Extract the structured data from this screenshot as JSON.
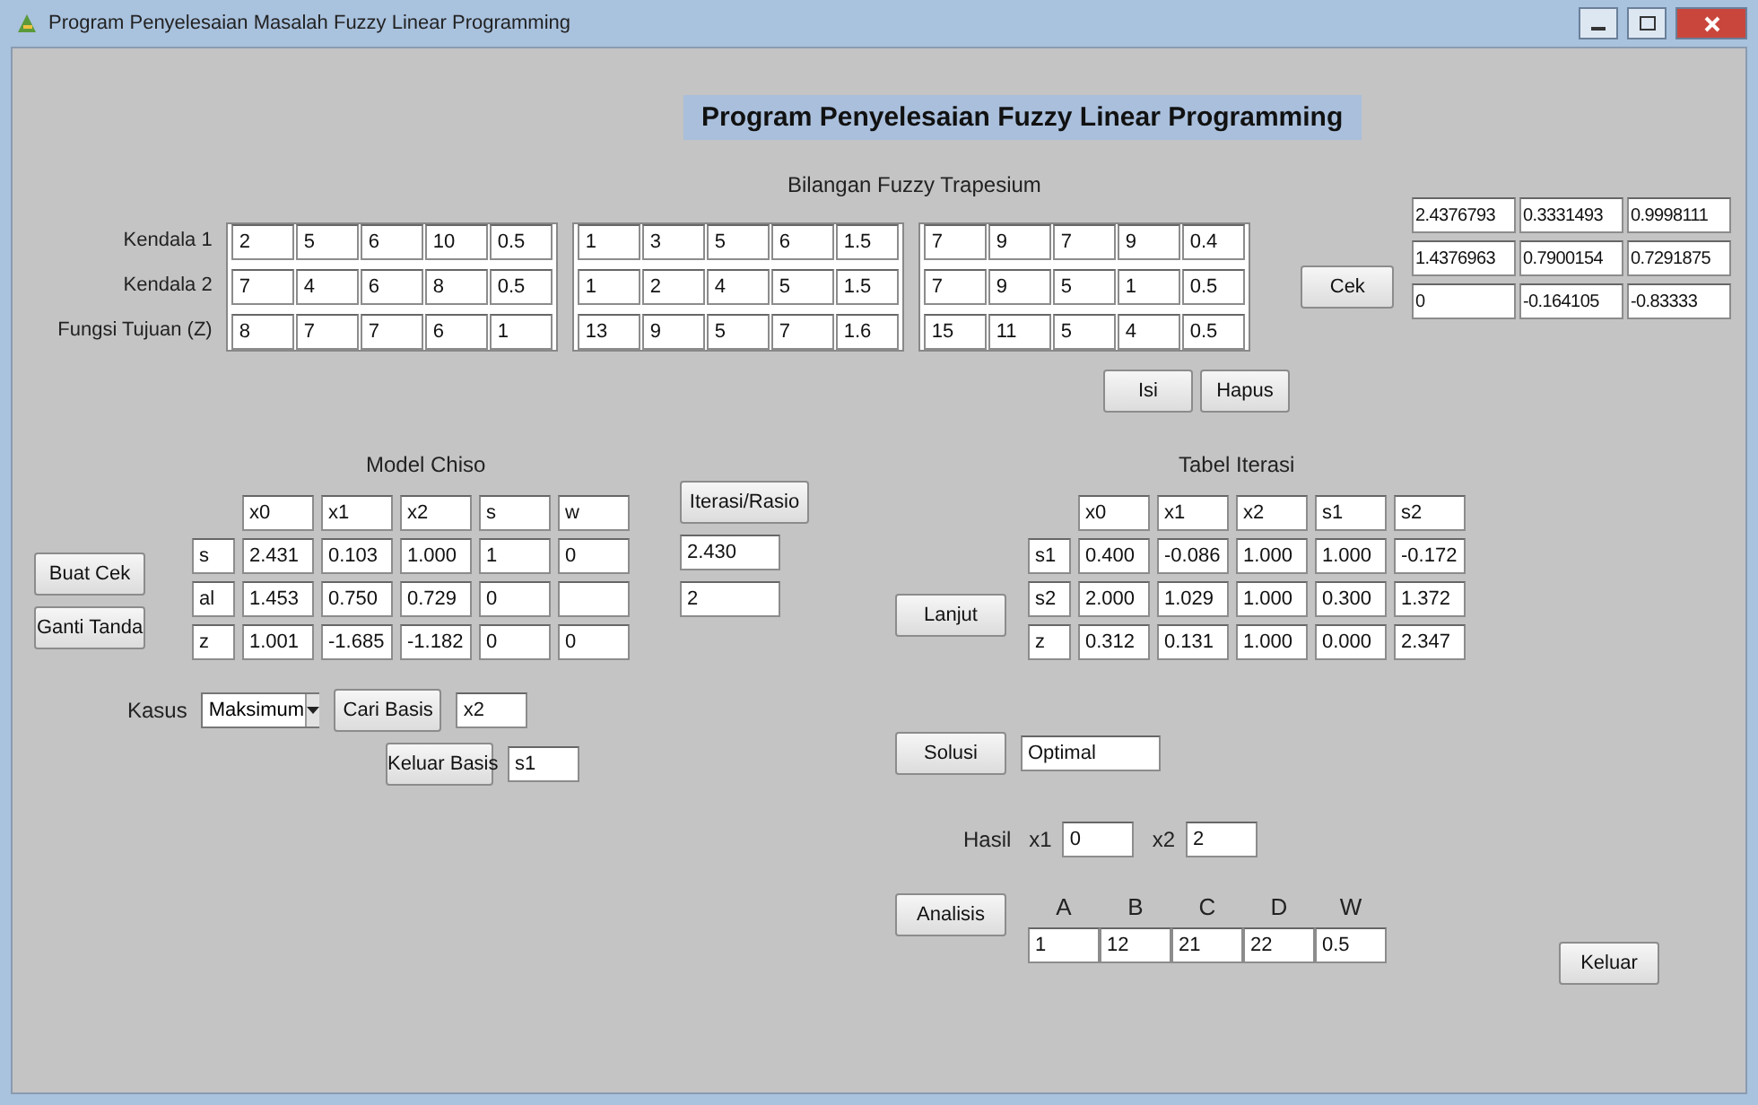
{
  "window": {
    "title": "Program Penyelesaian Masalah Fuzzy Linear Programming"
  },
  "heading": "Program Penyelesaian Fuzzy Linear Programming",
  "fuzzy": {
    "title": "Bilangan Fuzzy Trapesium",
    "rows": [
      {
        "label": "Kendala 1",
        "groups": [
          [
            "2",
            "5",
            "6",
            "10",
            "0.5"
          ],
          [
            "1",
            "3",
            "5",
            "6",
            "1.5"
          ],
          [
            "7",
            "9",
            "7",
            "9",
            "0.4"
          ]
        ]
      },
      {
        "label": "Kendala 2",
        "groups": [
          [
            "7",
            "4",
            "6",
            "8",
            "0.5"
          ],
          [
            "1",
            "2",
            "4",
            "5",
            "1.5"
          ],
          [
            "7",
            "9",
            "5",
            "1",
            "0.5"
          ]
        ]
      },
      {
        "label": "Fungsi Tujuan (Z)",
        "groups": [
          [
            "8",
            "7",
            "7",
            "6",
            "1"
          ],
          [
            "13",
            "9",
            "5",
            "7",
            "1.6"
          ],
          [
            "15",
            "11",
            "5",
            "4",
            "0.5"
          ]
        ]
      }
    ],
    "check_button": "Cek",
    "results": [
      [
        "2.4376793",
        "0.3331493",
        "0.9998111"
      ],
      [
        "1.4376963",
        "0.7900154",
        "0.7291875"
      ],
      [
        "0",
        "-0.164105",
        "-0.83333"
      ]
    ],
    "buttons": [
      "Isi",
      "Hapus"
    ]
  },
  "model": {
    "title": "Model Chiso",
    "headers": [
      "x0",
      "x1",
      "x2",
      "s",
      "w"
    ],
    "rows": [
      {
        "label": "s",
        "cells": [
          "2.431",
          "0.103",
          "1.000",
          "1",
          "0"
        ]
      },
      {
        "label": "al",
        "cells": [
          "1.453",
          "0.750",
          "0.729",
          "0",
          ""
        ]
      },
      {
        "label": "z",
        "cells": [
          "1.001",
          "-1.685",
          "-1.182",
          "0",
          "0"
        ]
      }
    ],
    "side_buttons": [
      "Buat Cek",
      "Ganti Tanda"
    ],
    "ratio_button": "Iterasi/Rasio",
    "ratios": [
      "2.430",
      "2"
    ]
  },
  "kasus": {
    "label": "Kasus",
    "select": "Maksimum",
    "actions": [
      {
        "button": "Cari Basis",
        "value": "x2"
      },
      {
        "button": "Keluar Basis",
        "value": "s1"
      }
    ]
  },
  "iteration": {
    "title": "Tabel Iterasi",
    "headers": [
      "x0",
      "x1",
      "x2",
      "s1",
      "s2"
    ],
    "rows": [
      {
        "label": "s1",
        "cells": [
          "0.400",
          "-0.086",
          "1.000",
          "1.000",
          "-0.172"
        ]
      },
      {
        "label": "s2",
        "cells": [
          "2.000",
          "1.029",
          "1.000",
          "0.300",
          "1.372"
        ]
      },
      {
        "label": "z",
        "cells": [
          "0.312",
          "0.131",
          "1.000",
          "0.000",
          "2.347"
        ]
      }
    ],
    "next_button": "Lanjut"
  },
  "solution": {
    "button": "Solusi",
    "value": "Optimal"
  },
  "result": {
    "label": "Hasil",
    "vars": [
      {
        "name": "x1",
        "value": "0"
      },
      {
        "name": "x2",
        "value": "2"
      }
    ]
  },
  "analysis": {
    "button": "Analisis",
    "columns": [
      {
        "name": "A",
        "value": "1"
      },
      {
        "name": "B",
        "value": "12"
      },
      {
        "name": "C",
        "value": "21"
      },
      {
        "name": "D",
        "value": "22"
      },
      {
        "name": "W",
        "value": "0.5"
      }
    ]
  },
  "exit_button": "Keluar"
}
